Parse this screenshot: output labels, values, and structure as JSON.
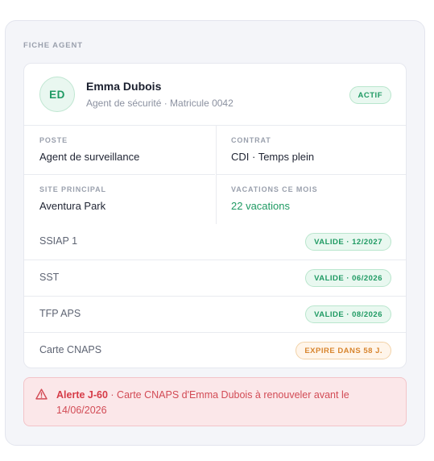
{
  "panel": {
    "title": "FICHE AGENT"
  },
  "agent": {
    "initials": "ED",
    "name": "Emma Dubois",
    "subtitle": "Agent de sécurité · Matricule 0042",
    "status": "ACTIF"
  },
  "details": [
    {
      "label": "POSTE",
      "value": "Agent de surveillance",
      "accent": false
    },
    {
      "label": "CONTRAT",
      "value": "CDI · Temps plein",
      "accent": false
    },
    {
      "label": "SITE PRINCIPAL",
      "value": "Aventura Park",
      "accent": false
    },
    {
      "label": "VACATIONS CE MOIS",
      "value": "22 vacations",
      "accent": true
    }
  ],
  "certifications": [
    {
      "name": "SSIAP 1",
      "status": "VALIDE · 12/2027",
      "tone": "green"
    },
    {
      "name": "SST",
      "status": "VALIDE · 06/2026",
      "tone": "green"
    },
    {
      "name": "TFP APS",
      "status": "VALIDE · 08/2026",
      "tone": "green"
    },
    {
      "name": "Carte CNAPS",
      "status": "EXPIRE DANS 58 J.",
      "tone": "orange"
    }
  ],
  "alert": {
    "icon": "warning-triangle-icon",
    "title": "Alerte J-60",
    "message": " · Carte CNAPS d'Emma Dubois à renouveler avant le 14/06/2026"
  },
  "colors": {
    "accent": "#1f9a63",
    "warning": "#d8852e",
    "danger": "#d24b55"
  }
}
